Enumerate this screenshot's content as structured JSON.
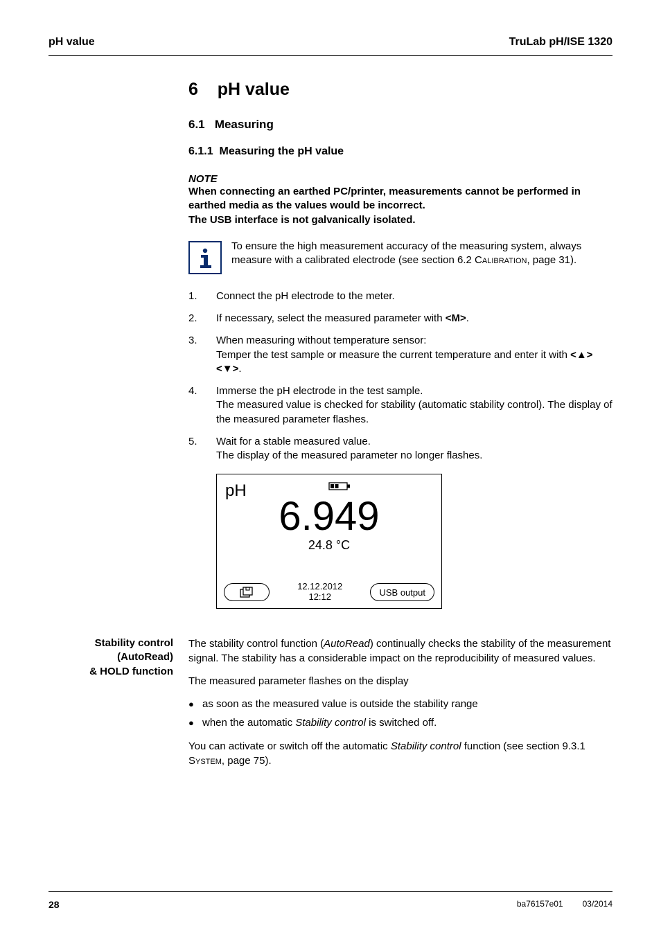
{
  "header": {
    "left": "pH value",
    "right": "TruLab pH/ISE 1320"
  },
  "chapter": {
    "number": "6",
    "title": "pH value"
  },
  "section": {
    "number": "6.1",
    "title": "Measuring"
  },
  "subsection": {
    "number": "6.1.1",
    "title": "Measuring the pH value"
  },
  "note": {
    "title": "NOTE",
    "line1": "When connecting an earthed PC/printer, measurements cannot be performed in earthed media as the values would be incorrect",
    "line2": "The USB interface is not galvanically isolated."
  },
  "info": {
    "pre": "To ensure the high measurement accuracy of the measuring system, always measure with a calibrated electrode (see section 6.2 ",
    "sc": "Calibration",
    "post": ", page 31)."
  },
  "steps": [
    "Connect the pH electrode to the meter.",
    "If necessary, select the measured parameter with ",
    "When measuring without temperature sensor:\nTemper the test sample or measure the current temperature and enter it with ",
    "Immerse the pH electrode in the test sample.\nThe measured value is checked for stability (automatic stability control). The display of the measured parameter flashes.",
    "Wait for a stable measured value.\nThe display of the measured parameter no longer flashes."
  ],
  "step2_key": "<M>",
  "display": {
    "unit": "pH",
    "value": "6.949",
    "temp": "24.8 °C",
    "date": "12.12.2012",
    "time": "12:12",
    "usb": "USB output"
  },
  "stability": {
    "label_l1": "Stability control",
    "label_l2": "(AutoRead)",
    "label_l3": "& HOLD function",
    "para1_a": "The stability control function (",
    "para1_it": "AutoRead",
    "para1_b": ") continually checks the stability of the measurement signal. The stability has a considerable impact on the reproducibility of measured values.",
    "para2": "The measured parameter flashes on the display",
    "bullet1": "as soon as the measured value is outside the stability range",
    "bullet2_a": "when the automatic ",
    "bullet2_it": "Stability control",
    "bullet2_b": " is switched off.",
    "para3_a": "You can activate or switch off the automatic ",
    "para3_it": "Stability control",
    "para3_b": " function (see section 9.3.1 ",
    "para3_sc": "System",
    "para3_c": ", page 75)."
  },
  "footer": {
    "page": "28",
    "doc": "ba76157e01",
    "date": "03/2014"
  }
}
